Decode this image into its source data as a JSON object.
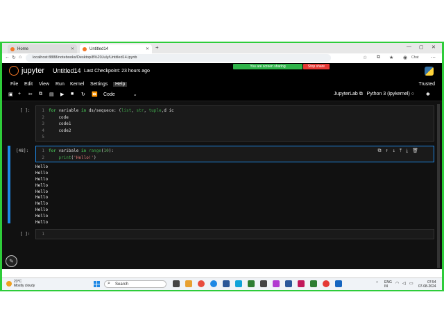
{
  "browser": {
    "tabs": [
      {
        "label": "Home"
      },
      {
        "label": "Untitled14"
      }
    ],
    "new_tab": "+",
    "url": "localhost:8888/notebooks/Desktop/8%20July/Untitled14.ipynb",
    "profile_label": "Chat"
  },
  "share": {
    "sharing_text": "You are screen sharing",
    "stop_text": "Stop share"
  },
  "jupyter": {
    "logo_text": "jupyter",
    "notebook_title": "Untitled14",
    "checkpoint": "Last Checkpoint: 23 hours ago",
    "menu": [
      "File",
      "Edit",
      "View",
      "Run",
      "Kernel",
      "Settings",
      "Help"
    ],
    "trusted": "Trusted",
    "cell_type": "Code",
    "jupyterlab_label": "JupyterLab",
    "kernel_label": "Python 3 (ipykernel)"
  },
  "cells": [
    {
      "prompt": "[ ]:",
      "lines": [
        {
          "n": "1",
          "code": "for variable in ds/sequece: (list, str, tuple,d ic"
        },
        {
          "n": "2",
          "code": "    code"
        },
        {
          "n": "3",
          "code": "    code1"
        },
        {
          "n": "4",
          "code": "    code2"
        },
        {
          "n": "5",
          "code": ""
        }
      ]
    },
    {
      "prompt": "[48]:",
      "lines": [
        {
          "n": "1",
          "code": "for varibale in range(10):"
        },
        {
          "n": "2",
          "code": "    print('Hello!')"
        }
      ],
      "output": [
        "Hello",
        "Hello",
        "Hello",
        "Hello",
        "Hello",
        "Hello",
        "Hello",
        "Hello",
        "Hello",
        "Hello"
      ]
    },
    {
      "prompt": "[ ]:",
      "lines": [
        {
          "n": "1",
          "code": ""
        }
      ]
    }
  ],
  "taskbar": {
    "weather_temp": "23°C",
    "weather_desc": "Mostly cloudy",
    "search_placeholder": "Search",
    "lang_top": "ENG",
    "lang_bottom": "IN",
    "time": "07:54",
    "date": "07-08-2024"
  },
  "colors": {
    "border": "#2ecc3a",
    "accent": "#1e88e5",
    "keyword": "#3ea34a",
    "string": "#dd7777",
    "stop": "#e53935"
  }
}
